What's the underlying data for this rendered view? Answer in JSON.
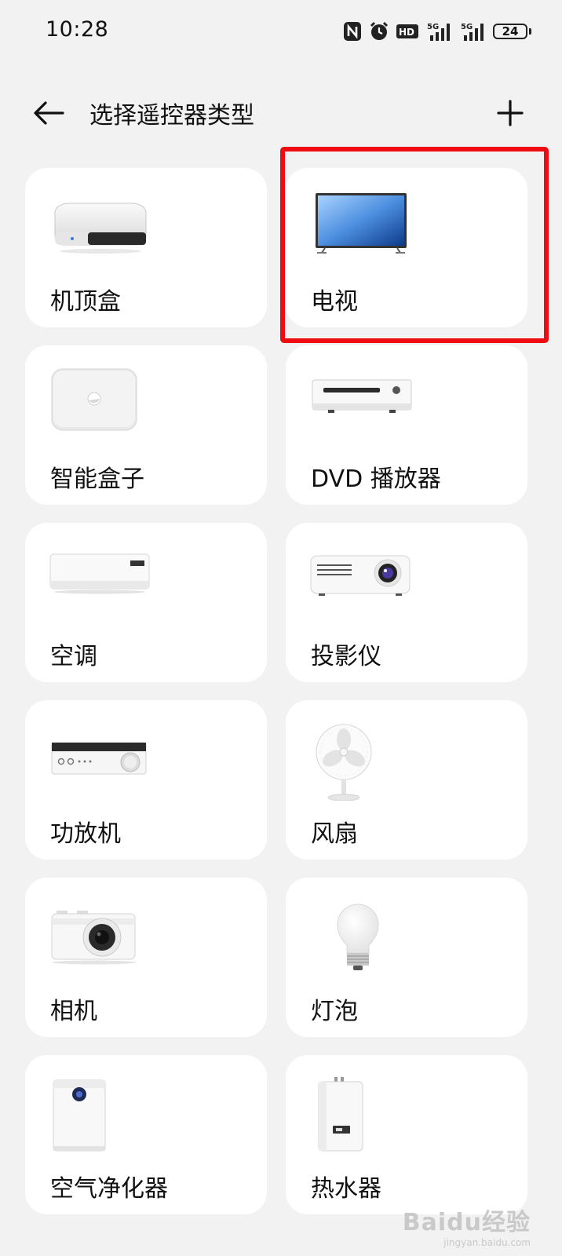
{
  "status_bar": {
    "time": "10:28",
    "battery": "24",
    "icons": [
      "nfc-icon",
      "alarm-icon",
      "hd-icon",
      "signal-5g-icon",
      "signal-5g-icon",
      "battery-icon"
    ],
    "network_1": "5G",
    "network_2": "5G",
    "hd_label": "HD"
  },
  "header": {
    "title": "选择遥控器类型",
    "back_icon": "arrow-left-icon",
    "add_icon": "plus-icon"
  },
  "devices": [
    {
      "label": "机顶盒",
      "icon": "set-top-box-icon"
    },
    {
      "label": "电视",
      "icon": "tv-icon",
      "highlighted": true
    },
    {
      "label": "智能盒子",
      "icon": "smart-box-icon"
    },
    {
      "label": "DVD 播放器",
      "icon": "dvd-player-icon"
    },
    {
      "label": "空调",
      "icon": "air-conditioner-icon"
    },
    {
      "label": "投影仪",
      "icon": "projector-icon"
    },
    {
      "label": "功放机",
      "icon": "amplifier-icon"
    },
    {
      "label": "风扇",
      "icon": "fan-icon"
    },
    {
      "label": "相机",
      "icon": "camera-icon"
    },
    {
      "label": "灯泡",
      "icon": "light-bulb-icon"
    },
    {
      "label": "空气净化器",
      "icon": "air-purifier-icon"
    },
    {
      "label": "热水器",
      "icon": "water-heater-icon"
    }
  ],
  "highlight_color": "#ee0c12",
  "watermark": {
    "main": "Baidu经验",
    "sub": "jingyan.baidu.com"
  }
}
